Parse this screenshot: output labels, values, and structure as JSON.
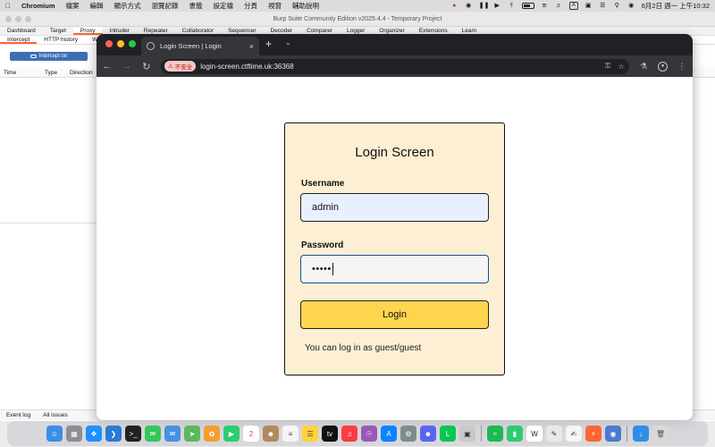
{
  "menubar": {
    "apple": "",
    "items": [
      "Chromium",
      "檔案",
      "編輯",
      "顯示方式",
      "瀏覽記錄",
      "書籤",
      "設定檔",
      "分頁",
      "視窗",
      "輔助說明"
    ],
    "ime": "A",
    "clock": "6月2日 週一 上午10:32"
  },
  "burp": {
    "title": "Burp Suite Community Edition v2025.4.4 - Temporary Project",
    "tabs": [
      "Dashboard",
      "Target",
      "Proxy",
      "Intruder",
      "Repeater",
      "Collaborator",
      "Sequencer",
      "Decoder",
      "Comparer",
      "Logger",
      "Organizer",
      "Extensions",
      "Learn"
    ],
    "subtabs": [
      "Intercept",
      "HTTP history",
      "W"
    ],
    "intercept_label": "Intercept on",
    "columns": [
      "Time",
      "Type",
      "Direction"
    ],
    "footer": [
      "Event log",
      "All issues"
    ]
  },
  "chrome": {
    "tab_title": "Login Screen | Login",
    "insecure_label": "不安全",
    "url": "login-screen.ctftime.uk:36368"
  },
  "page": {
    "title": "Login Screen",
    "username_label": "Username",
    "username_value": "admin",
    "password_label": "Password",
    "password_value": "•••••",
    "login_button": "Login",
    "hint": "You can log in as guest/guest"
  },
  "colors": {
    "card_bg": "#fcefd3",
    "login_button": "#ffd54f",
    "chrome_dark": "#35363a",
    "burp_accent": "#ff6633"
  },
  "dock": {
    "icons": [
      "finder-icon",
      "launchpad-icon",
      "safari-icon",
      "vscode-icon",
      "terminal-icon",
      "messages-icon",
      "mail-icon",
      "maps-icon",
      "photos-icon",
      "facetime-icon",
      "calendar-icon",
      "contacts-icon",
      "reminders-icon",
      "notes-icon",
      "appletv-icon",
      "music-icon",
      "podcasts-icon",
      "appstore-icon",
      "settings-icon",
      "discord-icon",
      "line-icon",
      "preview-icon",
      "spotify-icon",
      "numbers-icon",
      "word-icon",
      "script-icon",
      "textedit-icon",
      "burp-icon",
      "chromium-icon",
      "downloads-icon",
      "trash-icon"
    ],
    "calendar_day": "2"
  }
}
